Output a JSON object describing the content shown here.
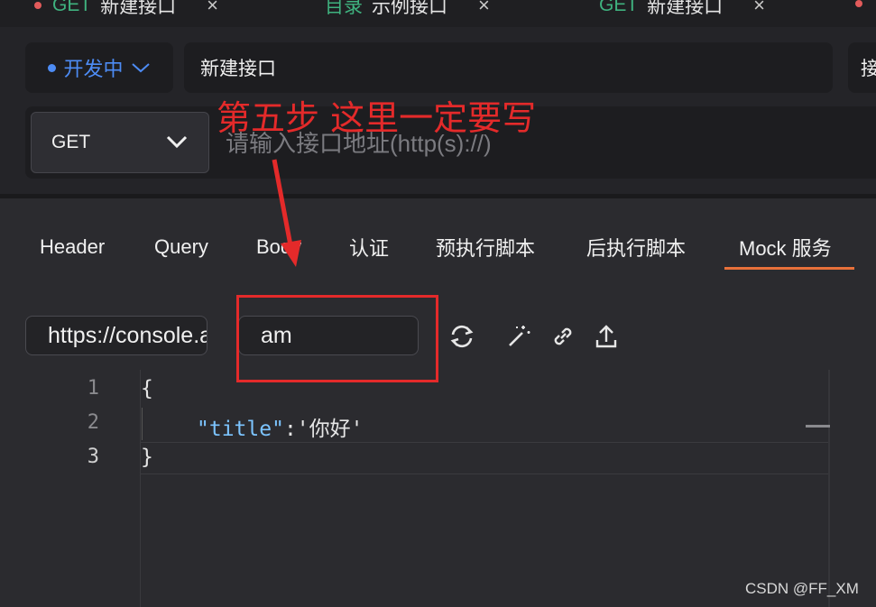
{
  "tabs": [
    {
      "method": "GET",
      "name": "新建接口",
      "close": "×"
    },
    {
      "method": "目录",
      "name": "示例接口",
      "close": "×"
    },
    {
      "method": "GET",
      "name": "新建接口",
      "close": "×"
    }
  ],
  "header": {
    "status": "开发中",
    "api_name": "新建接口",
    "right_label": "接",
    "method": "GET",
    "url_placeholder": "请输入接口地址(http(s)://)"
  },
  "subtabs": [
    "Header",
    "Query",
    "Body",
    "认证",
    "预执行脚本",
    "后执行脚本",
    "Mock 服务"
  ],
  "mock": {
    "url": "https://console.apipost.cn",
    "name": "am"
  },
  "editor": {
    "line_numbers": [
      "1",
      "2",
      "3"
    ],
    "line1": "{",
    "line2_key": "\"title\"",
    "line2_rest": ":'你好'",
    "line3": "}"
  },
  "annotation": {
    "text": "第五步 这里一定要写",
    "color": "#e42a2a"
  },
  "watermark": "CSDN @FF_XM",
  "colors": {
    "accent_orange": "#e8703a",
    "status_blue": "#4d8cf5",
    "method_green": "#3fb27f"
  },
  "icons": [
    "refresh-icon",
    "magic-wand-icon",
    "link-icon",
    "upload-icon",
    "chevron-down-icon"
  ]
}
